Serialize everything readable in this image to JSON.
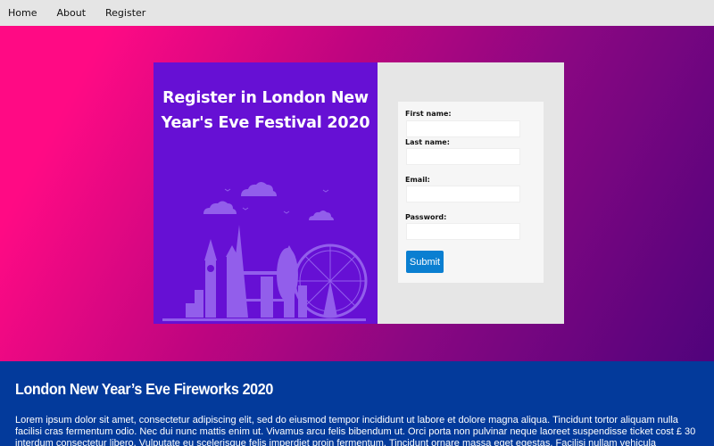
{
  "nav": {
    "items": [
      {
        "label": "Home"
      },
      {
        "label": "About"
      },
      {
        "label": "Register"
      }
    ]
  },
  "hero": {
    "title": "Register in London New Year's Eve Festival 2020",
    "illustration": "london-skyline-illustration"
  },
  "form": {
    "first_name_label": "First name:",
    "last_name_label": "Last name:",
    "email_label": "Email:",
    "password_label": "Password:",
    "first_name_value": "",
    "last_name_value": "",
    "email_value": "",
    "password_value": "",
    "submit_label": "Submit"
  },
  "info": {
    "title": "London New Year’s Eve Fireworks 2020",
    "body": "Lorem ipsum dolor sit amet, consectetur adipiscing elit, sed do eiusmod tempor incididunt ut labore et dolore magna aliqua. Tincidunt tortor aliquam nulla facilisi cras fermentum odio. Nec dui nunc mattis enim ut. Vivamus arcu felis bibendum ut. Orci porta non pulvinar neque laoreet suspendisse ticket cost £ 30 interdum consectetur libero. Vulputate eu scelerisque felis imperdiet proin fermentum. Tincidunt ornare massa eget egestas. Facilisi nullam vehicula"
  },
  "colors": {
    "nav_bg": "#e5e5e5",
    "hero_gradient_start": "#ff0a84",
    "hero_gradient_end": "#50037c",
    "card_left_bg": "#6610d4",
    "card_right_bg": "#e6e6e6",
    "submit_bg": "#0a7fd1",
    "info_bg": "#033a9b"
  }
}
